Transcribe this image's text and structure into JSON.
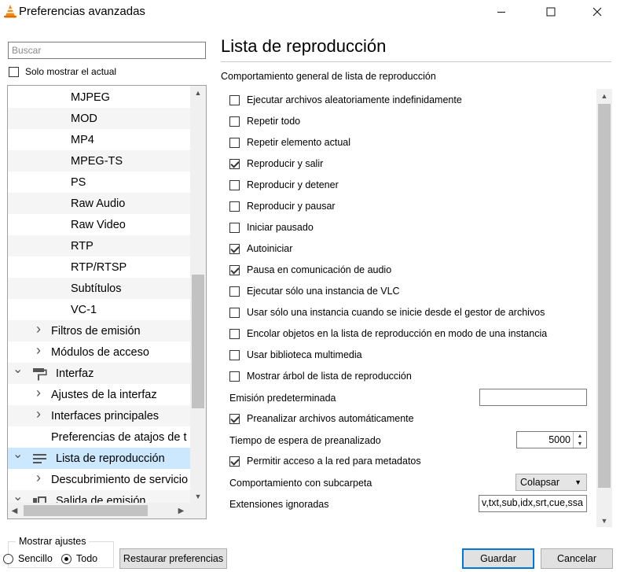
{
  "window": {
    "title": "Preferencias avanzadas",
    "icons": {
      "app": "vlc-cone-icon",
      "minimize": "minimize-icon",
      "maximize": "maximize-icon",
      "close": "close-icon"
    }
  },
  "sidebar": {
    "search_placeholder": "Buscar",
    "only_current_label": "Solo mostrar el actual",
    "only_current_checked": false,
    "tree": [
      {
        "label": "MJPEG",
        "level": 2
      },
      {
        "label": "MOD",
        "level": 2
      },
      {
        "label": "MP4",
        "level": 2
      },
      {
        "label": "MPEG-TS",
        "level": 2
      },
      {
        "label": "PS",
        "level": 2
      },
      {
        "label": "Raw Audio",
        "level": 2
      },
      {
        "label": "Raw Video",
        "level": 2
      },
      {
        "label": "RTP",
        "level": 2
      },
      {
        "label": "RTP/RTSP",
        "level": 2
      },
      {
        "label": "Subtítulos",
        "level": 2
      },
      {
        "label": "VC-1",
        "level": 2
      },
      {
        "label": "Filtros de emisión",
        "level": 1,
        "expander": "collapsed"
      },
      {
        "label": "Módulos de acceso",
        "level": 1,
        "expander": "collapsed"
      },
      {
        "label": "Interfaz",
        "level": 0,
        "expander": "expanded",
        "icon": "paint-roller-icon"
      },
      {
        "label": "Ajustes de la interfaz",
        "level": 1,
        "expander": "collapsed"
      },
      {
        "label": "Interfaces principales",
        "level": 1,
        "expander": "collapsed"
      },
      {
        "label": "Preferencias de atajos de t",
        "level": 1
      },
      {
        "label": "Lista de reproducción",
        "level": 0,
        "expander": "expanded",
        "icon": "playlist-icon",
        "selected": true
      },
      {
        "label": "Descubrimiento de servicio",
        "level": 1,
        "expander": "collapsed"
      },
      {
        "label": "Salida de emisión",
        "level": 0,
        "expander": "expanded",
        "icon": "stream-output-icon"
      }
    ]
  },
  "main": {
    "title": "Lista de reproducción",
    "section_label": "Comportamiento general de lista de reproducción",
    "options": [
      {
        "type": "checkbox",
        "label": "Ejecutar archivos aleatoriamente indefinidamente",
        "checked": false
      },
      {
        "type": "checkbox",
        "label": "Repetir todo",
        "checked": false
      },
      {
        "type": "checkbox",
        "label": "Repetir elemento actual",
        "checked": false
      },
      {
        "type": "checkbox",
        "label": "Reproducir y salir",
        "checked": true
      },
      {
        "type": "checkbox",
        "label": "Reproducir y detener",
        "checked": false
      },
      {
        "type": "checkbox",
        "label": "Reproducir y pausar",
        "checked": false
      },
      {
        "type": "checkbox",
        "label": "Iniciar pausado",
        "checked": false
      },
      {
        "type": "checkbox",
        "label": "Autoiniciar",
        "checked": true
      },
      {
        "type": "checkbox",
        "label": "Pausa en comunicación de audio",
        "checked": true
      },
      {
        "type": "checkbox",
        "label": "Ejecutar sólo una instancia de VLC",
        "checked": false
      },
      {
        "type": "checkbox",
        "label": "Usar sólo una instancia cuando se inicie desde el gestor de archivos",
        "checked": false
      },
      {
        "type": "checkbox",
        "label": "Encolar objetos en la lista de reproducción en modo de una instancia",
        "checked": false
      },
      {
        "type": "checkbox",
        "label": "Usar biblioteca multimedia",
        "checked": false
      },
      {
        "type": "checkbox",
        "label": "Mostrar árbol de lista de reproducción",
        "checked": false
      },
      {
        "type": "text",
        "label": "Emisión predeterminada",
        "value": ""
      },
      {
        "type": "checkbox",
        "label": "Preanalizar archivos automáticamente",
        "checked": true
      },
      {
        "type": "spin",
        "label": "Tiempo de espera de preanalizado",
        "value": "5000"
      },
      {
        "type": "checkbox",
        "label": "Permitir acceso a la red para metadatos",
        "checked": true
      },
      {
        "type": "combo",
        "label": "Comportamiento con subcarpeta",
        "value": "Colapsar"
      },
      {
        "type": "text",
        "label": "Extensiones ignoradas",
        "value": "v,txt,sub,idx,srt,cue,ssa"
      }
    ]
  },
  "footer": {
    "show_settings_label": "Mostrar ajustes",
    "simple_label": "Sencillo",
    "all_label": "Todo",
    "selected_mode": "all",
    "reset_label": "Restaurar preferencias",
    "save_label": "Guardar",
    "cancel_label": "Cancelar"
  }
}
